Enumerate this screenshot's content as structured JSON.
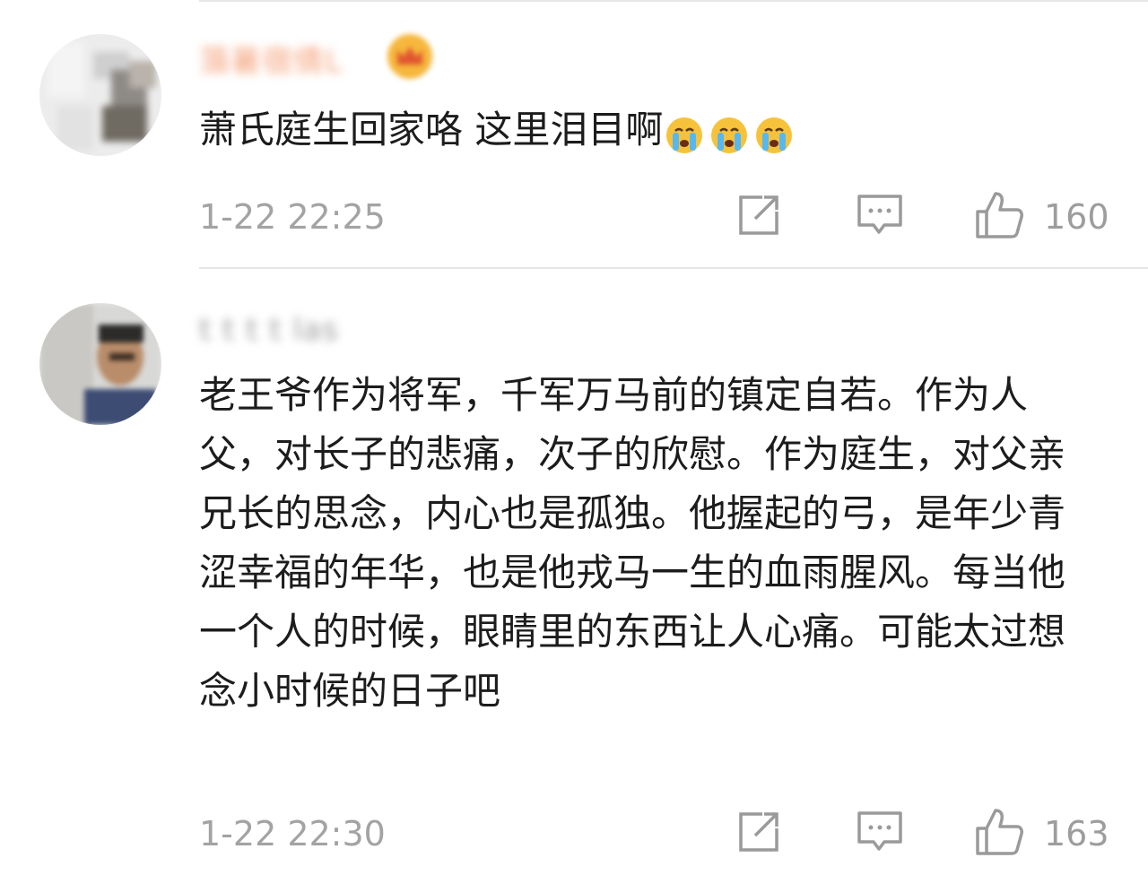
{
  "comments": [
    {
      "username": "蒗暑宿倩L",
      "text": "萧氏庭生回家咯 这里泪目啊",
      "emoji": [
        "crying-emoji",
        "crying-emoji",
        "crying-emoji"
      ],
      "timestamp": "1-22 22:25",
      "like_count": "160",
      "badge_icon": "vip-crown-icon"
    },
    {
      "username": "t t t t las",
      "text": "老王爷作为将军，千军万马前的镇定自若。作为人父，对长子的悲痛，次子的欣慰。作为庭生，对父亲兄长的思念，内心也是孤独。他握起的弓，是年少青涩幸福的年华，也是他戎马一生的血雨腥风。每当他一个人的时候，眼睛里的东西让人心痛。可能太过想念小时候的日子吧",
      "timestamp": "1-22 22:30",
      "like_count": "163"
    }
  ],
  "icons": {
    "share": "share-icon",
    "reply": "comment-icon",
    "like": "thumbs-up-icon"
  },
  "colors": {
    "text": "#1c1c1c",
    "meta": "#a3a3a3",
    "icon": "#9a9a9a",
    "divider": "#e6e6e6"
  }
}
